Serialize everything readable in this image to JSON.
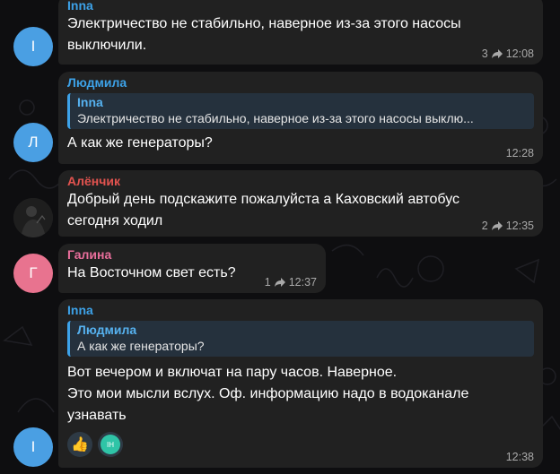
{
  "messages": [
    {
      "sender": "Inna",
      "sender_color": "#3da2e8",
      "avatar_letter": "I",
      "avatar_color": "#4a9fe3",
      "lines": [
        "Электричество не стабильно, наверное из-за этого насосы",
        "выключили."
      ],
      "forward_count": "3",
      "time": "12:08"
    },
    {
      "sender": "Людмила",
      "sender_color": "#3da2e8",
      "avatar_letter": "Л",
      "avatar_color": "#4a9fe3",
      "reply_name": "Inna",
      "reply_text": "Электричество не стабильно, наверное из-за этого насосы выклю...",
      "lines": [
        "А как же генераторы?"
      ],
      "time": "12:28"
    },
    {
      "sender": "Алёнчик",
      "sender_color": "#e2534f",
      "avatar_letter": "",
      "avatar_color": "#2a2a2a",
      "lines": [
        "Добрый день подскажите пожалуйста а Каховский автобус",
        "сегодня ходил"
      ],
      "forward_count": "2",
      "time": "12:35"
    },
    {
      "sender": "Галина",
      "sender_color": "#e86e9b",
      "avatar_letter": "Г",
      "avatar_color": "#e8738f",
      "lines": [
        "На Восточном свет есть?"
      ],
      "forward_count": "1",
      "time": "12:37"
    },
    {
      "sender": "Inna",
      "sender_color": "#3da2e8",
      "avatar_letter": "I",
      "avatar_color": "#4a9fe3",
      "reply_name": "Людмила",
      "reply_text": "А как же генераторы?",
      "lines": [
        "Вот вечером и включат на пару часов. Наверное.",
        "Это мои мысли вслух. Оф. информацию надо в водоканале",
        "узнавать"
      ],
      "reactions": [
        {
          "icon": "thumbs-up",
          "label": "👍"
        },
        {
          "icon": "avatar-ih",
          "label": "IH"
        }
      ],
      "time": "12:38"
    }
  ]
}
